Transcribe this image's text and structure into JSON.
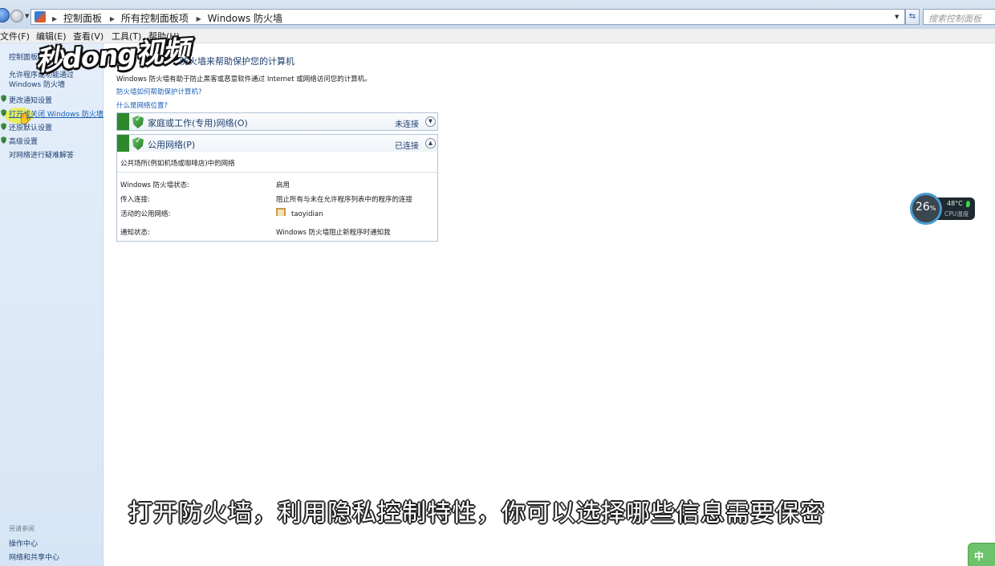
{
  "address_bar": {
    "crumbs": [
      "控制面板",
      "所有控制面板项",
      "Windows 防火墙"
    ],
    "search_placeholder": "搜索控制面板"
  },
  "menu": [
    "文件(F)",
    "编辑(E)",
    "查看(V)",
    "工具(T)",
    "帮助(H)"
  ],
  "sidebar": {
    "home": "控制面板主页",
    "items": [
      "允许程序或功能通过 Windows 防火墙",
      "更改通知设置",
      "打开或关闭 Windows 防火墙",
      "还原默认设置",
      "高级设置",
      "对网络进行疑难解答"
    ],
    "see_also_title": "另请参阅",
    "see_also": [
      "操作中心",
      "网络和共享中心"
    ]
  },
  "watermark": "秒dong视频",
  "main": {
    "title": "防火墙来帮助保护您的计算机",
    "description": "Windows 防火墙有助于防止黑客或恶意软件通过 Internet 或网络访问您的计算机。",
    "link_help": "防火墙如何帮助保护计算机?",
    "link_location": "什么是网络位置?",
    "networks": [
      {
        "name": "家庭或工作(专用)网络(O)",
        "status": "未连接",
        "expanded": false
      },
      {
        "name": "公用网络(P)",
        "status": "已连接",
        "expanded": true
      }
    ],
    "details": {
      "header": "公共场所(例如机场或咖啡店)中的网络",
      "rows": [
        {
          "key": "Windows 防火墙状态:",
          "value": "启用"
        },
        {
          "key": "传入连接:",
          "value": "阻止所有与未在允许程序列表中的程序的连接"
        },
        {
          "key": "活动的公用网络:",
          "value": "taoyidian"
        },
        {
          "key": "通知状态:",
          "value": "Windows 防火墙阻止新程序时通知我"
        }
      ]
    }
  },
  "cpu_widget": {
    "percent": "26",
    "percent_unit": "%",
    "temperature": "48°C",
    "label": "CPU温度"
  },
  "subtitle": "打开防火墙，利用隐私控制特性，你可以选择哪些信息需要保密",
  "ime_label": "中",
  "colors": {
    "firewall_green": "#2c8a2c",
    "link_blue": "#1a5fb4",
    "title_blue": "#1e3f6e"
  }
}
